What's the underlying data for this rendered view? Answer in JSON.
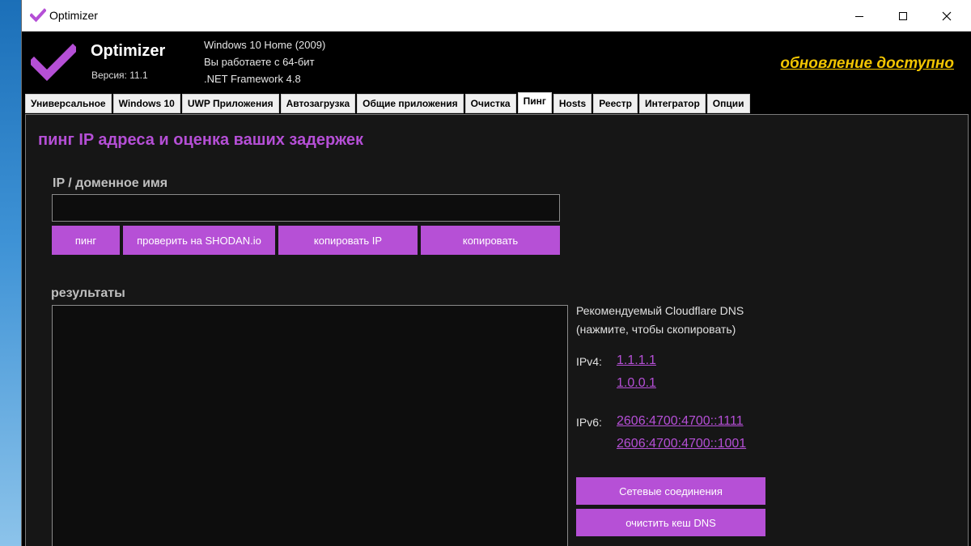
{
  "titlebar": {
    "title": "Optimizer"
  },
  "header": {
    "app_name": "Optimizer",
    "version": "Версия: 11.1",
    "os_info": "Windows 10 Home (2009)",
    "arch_info": "Вы работаете с 64-бит",
    "framework_info": ".NET Framework 4.8",
    "update_link": "обновление доступно"
  },
  "tabs": [
    {
      "label": "Универсальное"
    },
    {
      "label": "Windows 10"
    },
    {
      "label": "UWP Приложения"
    },
    {
      "label": "Автозагрузка"
    },
    {
      "label": "Общие приложения"
    },
    {
      "label": "Очистка"
    },
    {
      "label": "Пинг"
    },
    {
      "label": "Hosts"
    },
    {
      "label": "Реестр"
    },
    {
      "label": "Интегратор"
    },
    {
      "label": "Опции"
    }
  ],
  "active_tab": "Пинг",
  "ping": {
    "title": "пинг IP адреса и оценка ваших задержек",
    "field_label": "IP / доменное имя",
    "input_value": "",
    "buttons": {
      "ping": "пинг",
      "shodan": "проверить на SHODAN.io",
      "copy_ip": "копировать IP",
      "copy": "копировать"
    },
    "results_label": "результаты",
    "results_text": ""
  },
  "dns": {
    "title_line1": "Рекомендуемый Cloudflare DNS",
    "title_line2": "(нажмите, чтобы скопировать)",
    "ipv4_label": "IPv4:",
    "ipv4": [
      "1.1.1.1",
      "1.0.0.1"
    ],
    "ipv6_label": "IPv6:",
    "ipv6": [
      "2606:4700:4700::1111",
      "2606:4700:4700::1001"
    ],
    "network_button": "Сетевые соединения",
    "flush_button": "очистить кеш DNS"
  },
  "colors": {
    "accent": "#b650d6",
    "update_link": "#f2c500",
    "background": "#000000",
    "panel": "#161616"
  }
}
